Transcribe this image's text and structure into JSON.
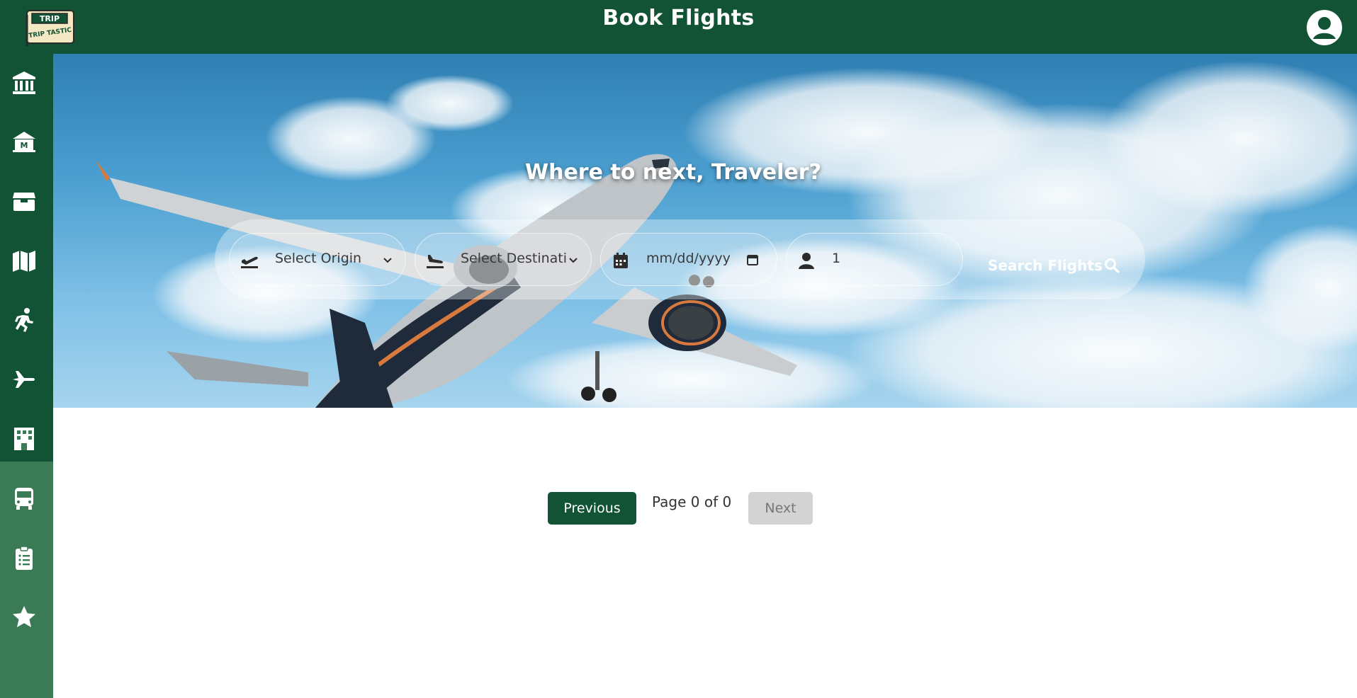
{
  "header": {
    "title": "Book Flights",
    "logo_text_top": "TRIP",
    "logo_text_bottom": "TRIP TASTIC"
  },
  "sidebar": {
    "items": [
      {
        "icon": "bank-icon"
      },
      {
        "icon": "museum-icon"
      },
      {
        "icon": "package-icon"
      },
      {
        "icon": "map-icon"
      },
      {
        "icon": "running-icon"
      },
      {
        "icon": "plane-icon"
      },
      {
        "icon": "hotel-icon"
      },
      {
        "icon": "bus-icon"
      },
      {
        "icon": "clipboard-icon"
      },
      {
        "icon": "star-icon"
      }
    ]
  },
  "hero": {
    "heading": "Where to next, Traveler?"
  },
  "search": {
    "origin_placeholder": "Select Origin",
    "destination_placeholder": "Select Destinati",
    "date_placeholder": "mm/dd/yyyy",
    "travelers_value": "1",
    "button_label": "Search Flights"
  },
  "pagination": {
    "previous_label": "Previous",
    "page_text": "Page 0 of 0",
    "next_label": "Next"
  },
  "colors": {
    "brand_green": "#115334",
    "sidebar_lower": "#3a7a55",
    "disabled_grey": "#d3d3d3"
  }
}
